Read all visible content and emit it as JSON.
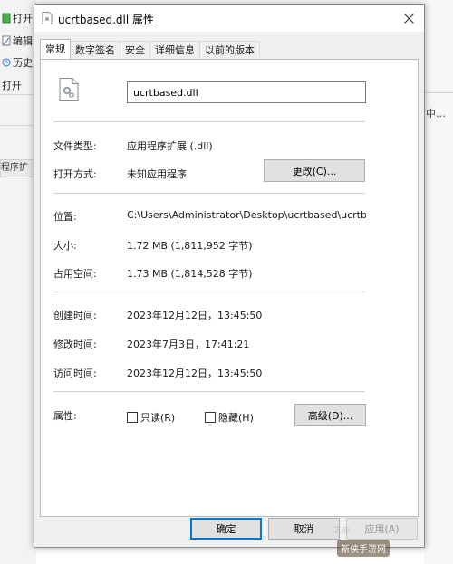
{
  "background": {
    "left_items": [
      {
        "label": "打开"
      },
      {
        "label": "编辑"
      },
      {
        "label": "历史"
      }
    ],
    "left_section": "打开",
    "left_bottom": "程序扩",
    "right_text": "中…"
  },
  "dialog": {
    "title": "ucrtbased.dll 属性",
    "tabs": [
      "常规",
      "数字签名",
      "安全",
      "详细信息",
      "以前的版本"
    ],
    "filename": "ucrtbased.dll",
    "fields": {
      "file_type_label": "文件类型:",
      "file_type_value": "应用程序扩展 (.dll)",
      "opens_with_label": "打开方式:",
      "opens_with_value": "未知应用程序",
      "change_button": "更改(C)...",
      "location_label": "位置:",
      "location_value": "C:\\Users\\Administrator\\Desktop\\ucrtbased\\ucrtb",
      "size_label": "大小:",
      "size_value": "1.72 MB (1,811,952 字节)",
      "size_on_disk_label": "占用空间:",
      "size_on_disk_value": "1.73 MB (1,814,528 字节)",
      "created_label": "创建时间:",
      "created_value": "2023年12月12日，13:45:50",
      "modified_label": "修改时间:",
      "modified_value": "2023年7月3日，17:41:21",
      "accessed_label": "访问时间:",
      "accessed_value": "2023年12月12日，13:45:50",
      "attributes_label": "属性:",
      "readonly_label": "只读(R)",
      "hidden_label": "隐藏(H)",
      "advanced_button": "高级(D)..."
    },
    "buttons": {
      "ok": "确定",
      "cancel": "取消",
      "apply": "应用(A)"
    }
  },
  "watermark": {
    "small": "之@",
    "main": "新侠手游网"
  }
}
